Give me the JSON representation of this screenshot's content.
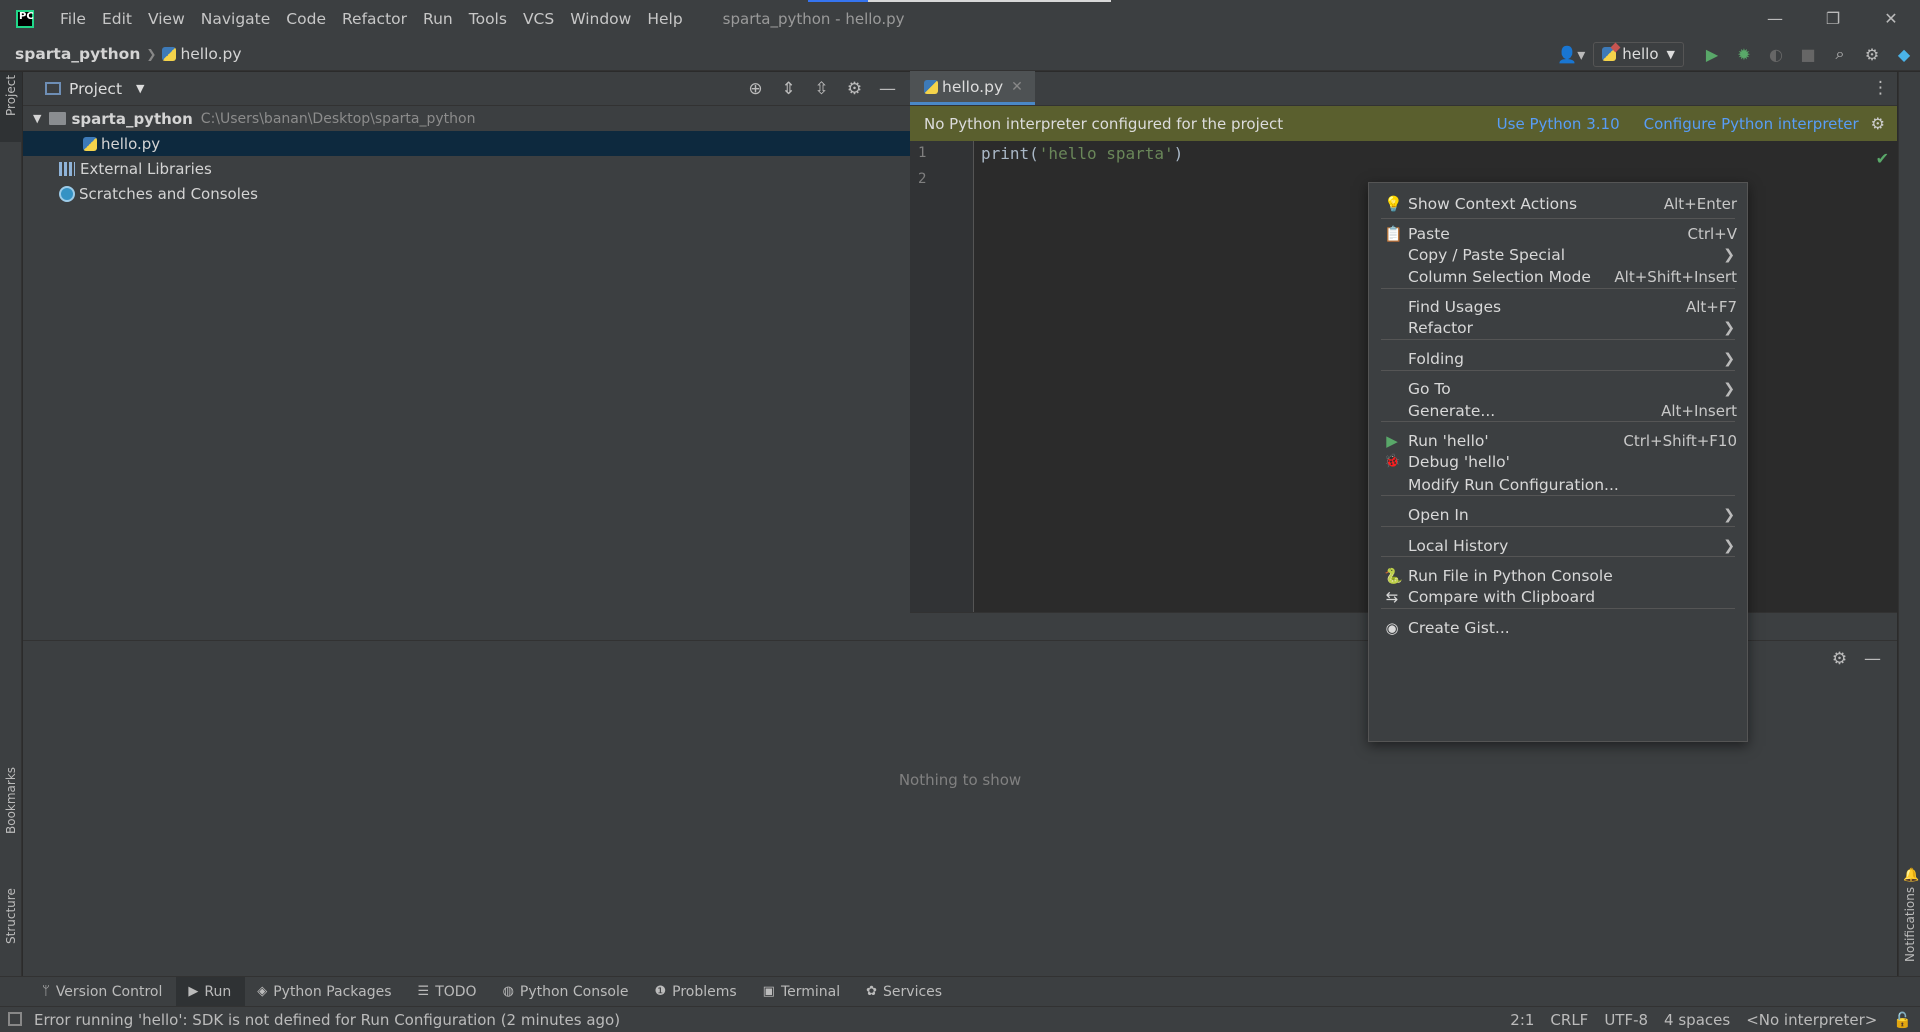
{
  "title_bar": {
    "menu": [
      "File",
      "Edit",
      "View",
      "Navigate",
      "Code",
      "Refactor",
      "Run",
      "Tools",
      "VCS",
      "Window",
      "Help"
    ],
    "window_title": "sparta_python - hello.py"
  },
  "nav_bar": {
    "project": "sparta_python",
    "file": "hello.py",
    "run_config": "hello"
  },
  "project_panel": {
    "title": "Project",
    "root_name": "sparta_python",
    "root_path": "C:\\Users\\banan\\Desktop\\sparta_python",
    "file": "hello.py",
    "external_libraries": "External Libraries",
    "scratches": "Scratches and Consoles"
  },
  "editor": {
    "tab": "hello.py",
    "banner_text": "No Python interpreter configured for the project",
    "banner_link_1": "Use Python 3.10",
    "banner_link_2": "Configure Python interpreter",
    "line_numbers": [
      "1",
      "2"
    ],
    "code_fn": "print(",
    "code_str": "'hello sparta'",
    "code_end": ")"
  },
  "context_menu": {
    "items": [
      {
        "label": "Show Context Actions",
        "shortcut": "Alt+Enter",
        "icon": "lightbulb-icon",
        "glyph": "💡"
      },
      {
        "label": "Paste",
        "shortcut": "Ctrl+V",
        "icon": "paste-icon",
        "glyph": "📋"
      },
      {
        "label": "Copy / Paste Special",
        "shortcut": "",
        "submenu": true
      },
      {
        "label": "Column Selection Mode",
        "shortcut": "Alt+Shift+Insert"
      },
      {
        "label": "Find Usages",
        "shortcut": "Alt+F7"
      },
      {
        "label": "Refactor",
        "shortcut": "",
        "submenu": true
      },
      {
        "label": "Folding",
        "shortcut": "",
        "submenu": true
      },
      {
        "label": "Go To",
        "shortcut": "",
        "submenu": true
      },
      {
        "label": "Generate...",
        "shortcut": "Alt+Insert"
      },
      {
        "label": "Run 'hello'",
        "shortcut": "Ctrl+Shift+F10",
        "icon": "run-icon",
        "glyph": "▶"
      },
      {
        "label": "Debug 'hello'",
        "shortcut": "",
        "icon": "debug-icon",
        "glyph": "🐞"
      },
      {
        "label": "Modify Run Configuration...",
        "shortcut": ""
      },
      {
        "label": "Open In",
        "shortcut": "",
        "submenu": true
      },
      {
        "label": "Local History",
        "shortcut": "",
        "submenu": true
      },
      {
        "label": "Run File in Python Console",
        "shortcut": "",
        "icon": "python-icon",
        "glyph": "🐍"
      },
      {
        "label": "Compare with Clipboard",
        "shortcut": "",
        "icon": "compare-icon",
        "glyph": "⇆"
      },
      {
        "label": "Create Gist...",
        "shortcut": "",
        "icon": "github-icon",
        "glyph": "◉"
      }
    ]
  },
  "run_panel": {
    "empty_text": "Nothing to show"
  },
  "left_stripe": {
    "project": "Project",
    "bookmarks": "Bookmarks",
    "structure": "Structure"
  },
  "right_stripe": {
    "notifications": "Notifications"
  },
  "tool_windows": [
    "Version Control",
    "Run",
    "Python Packages",
    "TODO",
    "Python Console",
    "Problems",
    "Terminal",
    "Services"
  ],
  "status_bar": {
    "message": "Error running 'hello': SDK is not defined for Run Configuration (2 minutes ago)",
    "position": "2:1",
    "line_sep": "CRLF",
    "encoding": "UTF-8",
    "indent": "4 spaces",
    "interpreter": "<No interpreter>"
  },
  "colors": {
    "banner_bg": "#5a5f2e",
    "link": "#589df6",
    "selection": "#0d293e",
    "run_green": "#59a869"
  }
}
